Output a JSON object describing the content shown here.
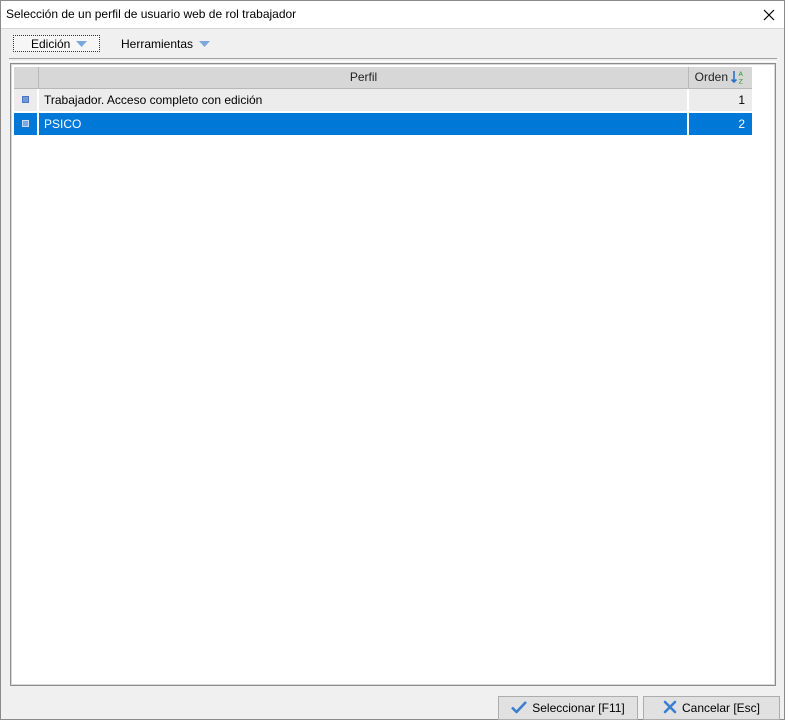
{
  "window": {
    "title": "Selección de un perfil de usuario web de rol trabajador"
  },
  "toolbar": {
    "edicion_label": "Edición",
    "herramientas_label": "Herramientas"
  },
  "grid": {
    "columns": {
      "perfil": "Perfil",
      "orden": "Orden"
    },
    "rows": [
      {
        "perfil": "Trabajador. Acceso completo con edición",
        "orden": "1",
        "selected": false
      },
      {
        "perfil": "PSICO",
        "orden": "2",
        "selected": true
      }
    ]
  },
  "buttons": {
    "select_label": "Seleccionar  [F11]",
    "cancel_label": "Cancelar  [Esc]"
  },
  "icons": {
    "close": "close-icon",
    "dropdown": "chevron-down-icon",
    "sort": "sort-ascending-icon",
    "select": "checkmark-icon",
    "cancel": "x-icon"
  },
  "colors": {
    "selection": "#0078d7",
    "row_indicator": "#6f9ad7"
  }
}
